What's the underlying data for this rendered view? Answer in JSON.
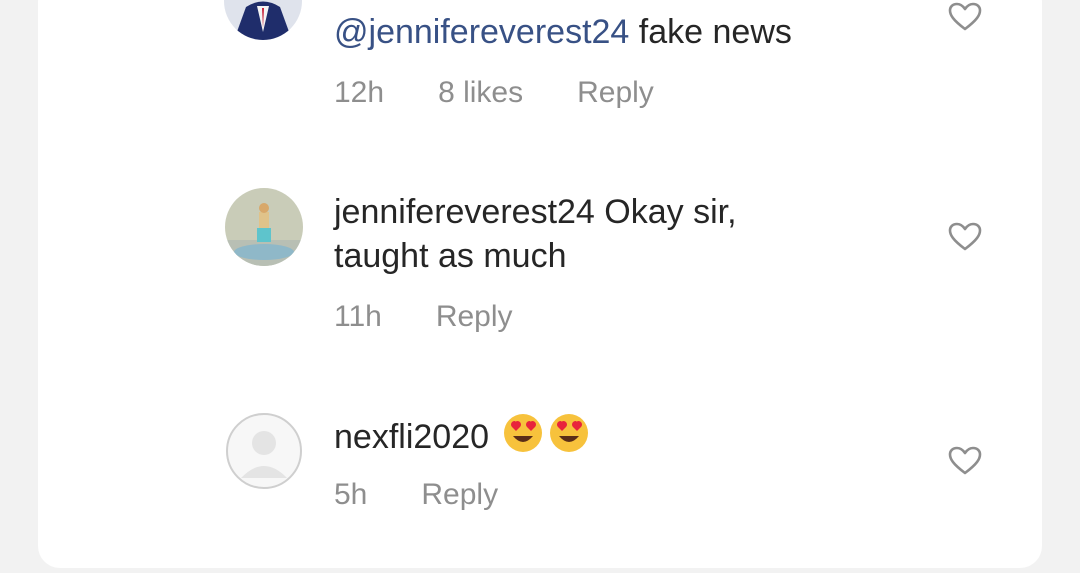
{
  "comments": [
    {
      "mention": "@jennifereverest24",
      "text": " fake news",
      "time": "12h",
      "likes": "8 likes",
      "reply_label": "Reply"
    },
    {
      "username": "jennifereverest24",
      "text": " Okay sir, taught as much",
      "time": "11h",
      "reply_label": "Reply"
    },
    {
      "username": "nexfli2020",
      "emojis": [
        "heart-eyes-emoji",
        "heart-eyes-emoji"
      ],
      "time": "5h",
      "reply_label": "Reply"
    }
  ],
  "colors": {
    "mention": "#385185",
    "text": "#262626",
    "meta": "#8e8e8e",
    "emoji_face": "#f7c23c",
    "emoji_heart": "#e8243c"
  },
  "icons": {
    "like": "heart-outline-icon"
  }
}
